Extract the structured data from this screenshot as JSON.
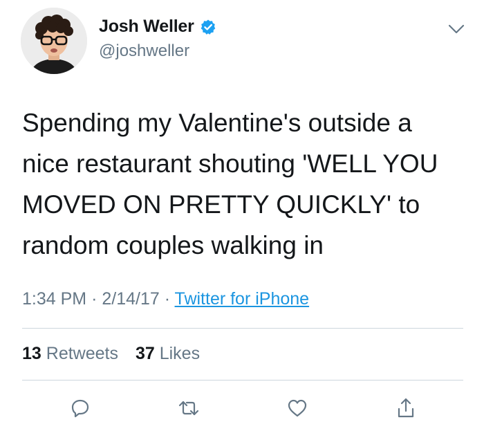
{
  "user": {
    "display_name": "Josh Weller",
    "handle": "@joshweller",
    "verified": true
  },
  "tweet": {
    "lines": [
      "Spending my Valentine's outside a",
      "nice restaurant shouting 'WELL YOU",
      "MOVED ON PRETTY QUICKLY' to",
      "random couples walking in"
    ],
    "time": "1:34 PM",
    "separator": "·",
    "date": "2/14/17",
    "source": "Twitter for iPhone"
  },
  "stats": {
    "retweets_count": "13",
    "retweets_label": "Retweets",
    "likes_count": "37",
    "likes_label": "Likes"
  },
  "icons": {
    "menu": "chevron-down-icon",
    "verified": "verified-badge-icon",
    "reply": "reply-icon",
    "retweet": "retweet-icon",
    "like": "heart-icon",
    "share": "share-icon"
  },
  "colors": {
    "text": "#14171a",
    "muted": "#657786",
    "link": "#1b95e0",
    "verified": "#1da1f2",
    "divider": "#ccd6dd",
    "icon": "#657786"
  }
}
